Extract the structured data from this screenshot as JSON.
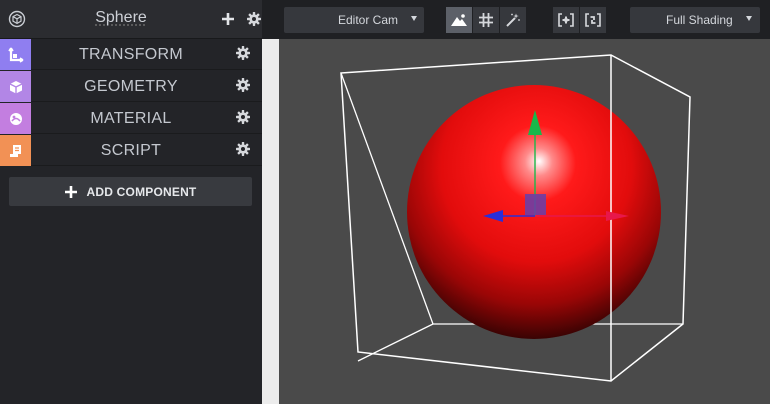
{
  "panel": {
    "entity_name": "Sphere",
    "icons": {
      "entity": "entity-cube-icon",
      "add": "plus-icon",
      "settings": "gear-icon"
    }
  },
  "components": [
    {
      "label": "TRANSFORM",
      "icon": "transform-axes-icon",
      "color": "#8f7ef0"
    },
    {
      "label": "GEOMETRY",
      "icon": "geometry-cube-icon",
      "color": "#b286e6"
    },
    {
      "label": "MATERIAL",
      "icon": "material-sphere-icon",
      "color": "#c37ee0"
    },
    {
      "label": "SCRIPT",
      "icon": "script-scroll-icon",
      "color": "#f29155"
    }
  ],
  "add_component": {
    "label": "ADD COMPONENT",
    "icon": "plus-icon"
  },
  "toolbar": {
    "camera": {
      "value": "Editor Cam",
      "icon": "caret-down-icon"
    },
    "view_tools": [
      {
        "icon": "landscape-icon",
        "active": true
      },
      {
        "icon": "grid-icon",
        "active": false
      },
      {
        "icon": "magic-wand-icon",
        "active": false
      }
    ],
    "frame_tools": [
      {
        "icon": "frame-selection-icon"
      },
      {
        "icon": "frame-all-icon"
      }
    ],
    "shading": {
      "value": "Full Shading",
      "icon": "caret-down-icon"
    }
  },
  "viewport": {
    "object": "sphere",
    "colors": {
      "background": "#4a4a4a",
      "sphere": "#e01010",
      "bounds": "#ffffff",
      "axis_x": "#e8174a",
      "axis_y": "#19b84a",
      "axis_z": "#2a2ed8"
    }
  }
}
